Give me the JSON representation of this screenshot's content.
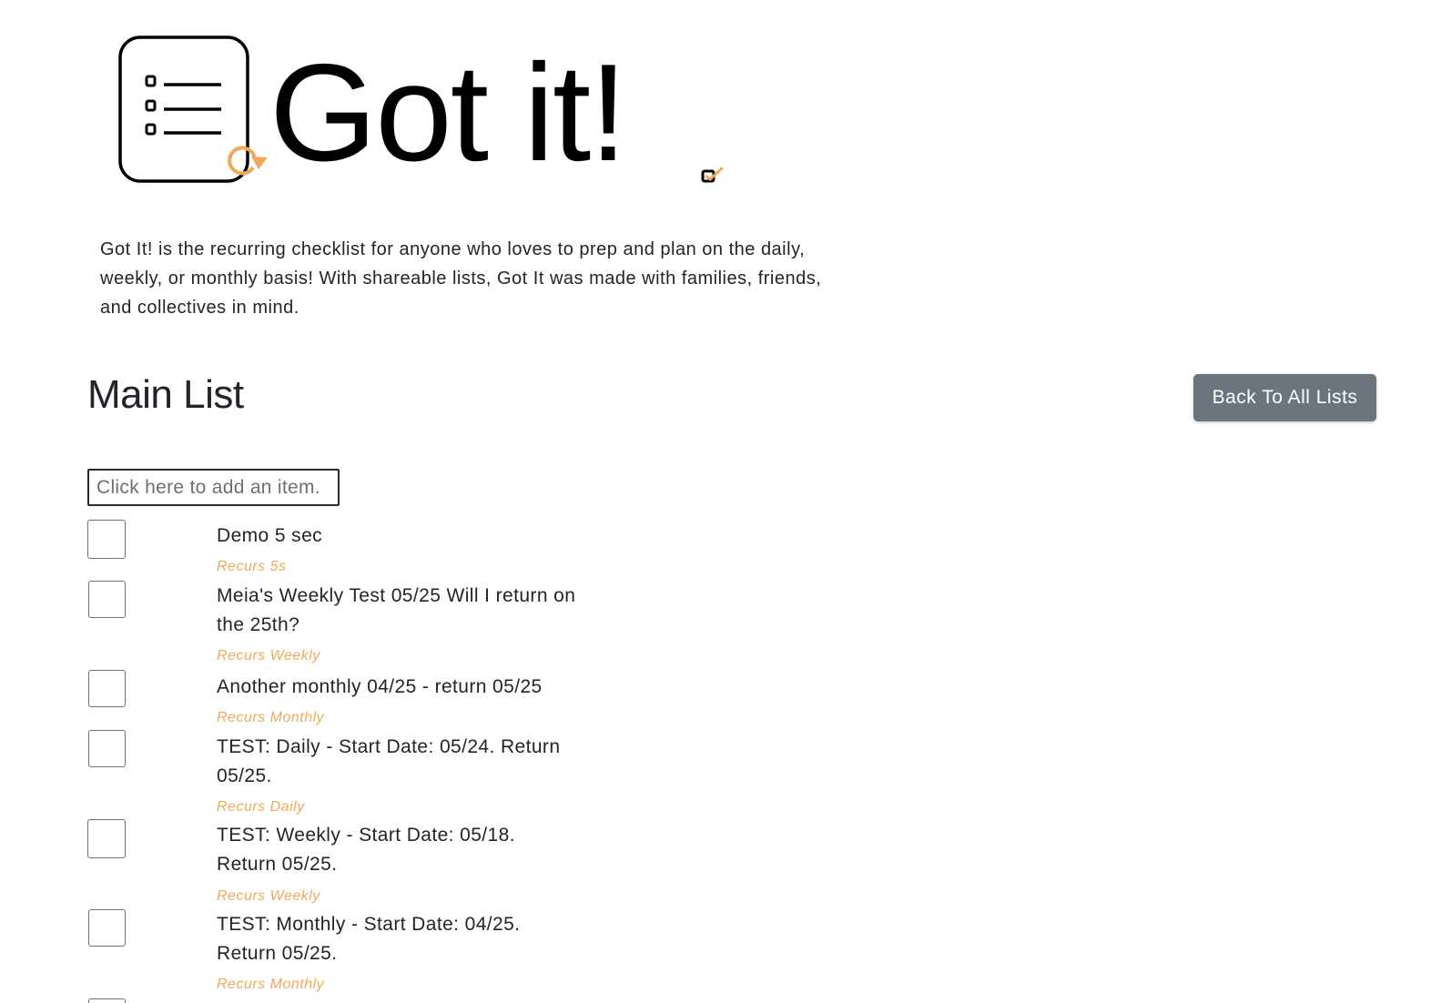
{
  "app": {
    "logo_text": "Got it!",
    "accent_color": "#f0a95a",
    "description": "Got It! is the recurring checklist for anyone who loves to prep and plan on the daily, weekly, or monthly basis! With shareable lists, Got It was made with families, friends, and collectives in mind."
  },
  "list": {
    "title": "Main List",
    "back_button_label": "Back To All Lists",
    "add_placeholder": "Click here to add an item.",
    "items": [
      {
        "text": "Demo 5 sec",
        "recurs": "Recurs 5s",
        "checked": false
      },
      {
        "text": "Meia's Weekly Test 05/25 Will I return on the 25th?",
        "recurs": "Recurs Weekly",
        "checked": false
      },
      {
        "text": "Another monthly 04/25 - return 05/25",
        "recurs": "Recurs Monthly",
        "checked": false
      },
      {
        "text": "TEST: Daily - Start Date: 05/24. Return 05/25.",
        "recurs": "Recurs Daily",
        "checked": false
      },
      {
        "text": "TEST: Weekly - Start Date: 05/18. Return 05/25.",
        "recurs": "Recurs Weekly",
        "checked": false
      },
      {
        "text": "TEST: Monthly - Start Date: 04/25. Return 05/25.",
        "recurs": "Recurs Monthly",
        "checked": false
      }
    ]
  }
}
